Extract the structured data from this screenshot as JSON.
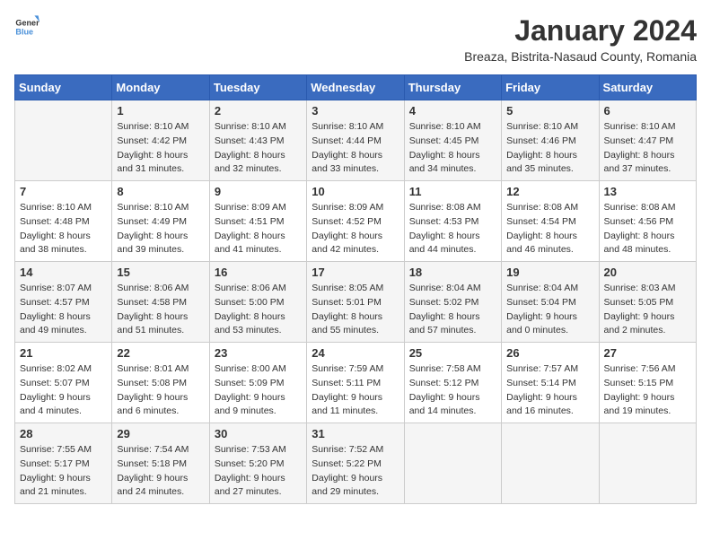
{
  "header": {
    "logo": {
      "general": "General",
      "blue": "Blue"
    },
    "title": "January 2024",
    "subtitle": "Breaza, Bistrita-Nasaud County, Romania"
  },
  "calendar": {
    "weekdays": [
      "Sunday",
      "Monday",
      "Tuesday",
      "Wednesday",
      "Thursday",
      "Friday",
      "Saturday"
    ],
    "weeks": [
      [
        {
          "day": "",
          "sunrise": "",
          "sunset": "",
          "daylight": ""
        },
        {
          "day": "1",
          "sunrise": "Sunrise: 8:10 AM",
          "sunset": "Sunset: 4:42 PM",
          "daylight": "Daylight: 8 hours and 31 minutes."
        },
        {
          "day": "2",
          "sunrise": "Sunrise: 8:10 AM",
          "sunset": "Sunset: 4:43 PM",
          "daylight": "Daylight: 8 hours and 32 minutes."
        },
        {
          "day": "3",
          "sunrise": "Sunrise: 8:10 AM",
          "sunset": "Sunset: 4:44 PM",
          "daylight": "Daylight: 8 hours and 33 minutes."
        },
        {
          "day": "4",
          "sunrise": "Sunrise: 8:10 AM",
          "sunset": "Sunset: 4:45 PM",
          "daylight": "Daylight: 8 hours and 34 minutes."
        },
        {
          "day": "5",
          "sunrise": "Sunrise: 8:10 AM",
          "sunset": "Sunset: 4:46 PM",
          "daylight": "Daylight: 8 hours and 35 minutes."
        },
        {
          "day": "6",
          "sunrise": "Sunrise: 8:10 AM",
          "sunset": "Sunset: 4:47 PM",
          "daylight": "Daylight: 8 hours and 37 minutes."
        }
      ],
      [
        {
          "day": "7",
          "sunrise": "Sunrise: 8:10 AM",
          "sunset": "Sunset: 4:48 PM",
          "daylight": "Daylight: 8 hours and 38 minutes."
        },
        {
          "day": "8",
          "sunrise": "Sunrise: 8:10 AM",
          "sunset": "Sunset: 4:49 PM",
          "daylight": "Daylight: 8 hours and 39 minutes."
        },
        {
          "day": "9",
          "sunrise": "Sunrise: 8:09 AM",
          "sunset": "Sunset: 4:51 PM",
          "daylight": "Daylight: 8 hours and 41 minutes."
        },
        {
          "day": "10",
          "sunrise": "Sunrise: 8:09 AM",
          "sunset": "Sunset: 4:52 PM",
          "daylight": "Daylight: 8 hours and 42 minutes."
        },
        {
          "day": "11",
          "sunrise": "Sunrise: 8:08 AM",
          "sunset": "Sunset: 4:53 PM",
          "daylight": "Daylight: 8 hours and 44 minutes."
        },
        {
          "day": "12",
          "sunrise": "Sunrise: 8:08 AM",
          "sunset": "Sunset: 4:54 PM",
          "daylight": "Daylight: 8 hours and 46 minutes."
        },
        {
          "day": "13",
          "sunrise": "Sunrise: 8:08 AM",
          "sunset": "Sunset: 4:56 PM",
          "daylight": "Daylight: 8 hours and 48 minutes."
        }
      ],
      [
        {
          "day": "14",
          "sunrise": "Sunrise: 8:07 AM",
          "sunset": "Sunset: 4:57 PM",
          "daylight": "Daylight: 8 hours and 49 minutes."
        },
        {
          "day": "15",
          "sunrise": "Sunrise: 8:06 AM",
          "sunset": "Sunset: 4:58 PM",
          "daylight": "Daylight: 8 hours and 51 minutes."
        },
        {
          "day": "16",
          "sunrise": "Sunrise: 8:06 AM",
          "sunset": "Sunset: 5:00 PM",
          "daylight": "Daylight: 8 hours and 53 minutes."
        },
        {
          "day": "17",
          "sunrise": "Sunrise: 8:05 AM",
          "sunset": "Sunset: 5:01 PM",
          "daylight": "Daylight: 8 hours and 55 minutes."
        },
        {
          "day": "18",
          "sunrise": "Sunrise: 8:04 AM",
          "sunset": "Sunset: 5:02 PM",
          "daylight": "Daylight: 8 hours and 57 minutes."
        },
        {
          "day": "19",
          "sunrise": "Sunrise: 8:04 AM",
          "sunset": "Sunset: 5:04 PM",
          "daylight": "Daylight: 9 hours and 0 minutes."
        },
        {
          "day": "20",
          "sunrise": "Sunrise: 8:03 AM",
          "sunset": "Sunset: 5:05 PM",
          "daylight": "Daylight: 9 hours and 2 minutes."
        }
      ],
      [
        {
          "day": "21",
          "sunrise": "Sunrise: 8:02 AM",
          "sunset": "Sunset: 5:07 PM",
          "daylight": "Daylight: 9 hours and 4 minutes."
        },
        {
          "day": "22",
          "sunrise": "Sunrise: 8:01 AM",
          "sunset": "Sunset: 5:08 PM",
          "daylight": "Daylight: 9 hours and 6 minutes."
        },
        {
          "day": "23",
          "sunrise": "Sunrise: 8:00 AM",
          "sunset": "Sunset: 5:09 PM",
          "daylight": "Daylight: 9 hours and 9 minutes."
        },
        {
          "day": "24",
          "sunrise": "Sunrise: 7:59 AM",
          "sunset": "Sunset: 5:11 PM",
          "daylight": "Daylight: 9 hours and 11 minutes."
        },
        {
          "day": "25",
          "sunrise": "Sunrise: 7:58 AM",
          "sunset": "Sunset: 5:12 PM",
          "daylight": "Daylight: 9 hours and 14 minutes."
        },
        {
          "day": "26",
          "sunrise": "Sunrise: 7:57 AM",
          "sunset": "Sunset: 5:14 PM",
          "daylight": "Daylight: 9 hours and 16 minutes."
        },
        {
          "day": "27",
          "sunrise": "Sunrise: 7:56 AM",
          "sunset": "Sunset: 5:15 PM",
          "daylight": "Daylight: 9 hours and 19 minutes."
        }
      ],
      [
        {
          "day": "28",
          "sunrise": "Sunrise: 7:55 AM",
          "sunset": "Sunset: 5:17 PM",
          "daylight": "Daylight: 9 hours and 21 minutes."
        },
        {
          "day": "29",
          "sunrise": "Sunrise: 7:54 AM",
          "sunset": "Sunset: 5:18 PM",
          "daylight": "Daylight: 9 hours and 24 minutes."
        },
        {
          "day": "30",
          "sunrise": "Sunrise: 7:53 AM",
          "sunset": "Sunset: 5:20 PM",
          "daylight": "Daylight: 9 hours and 27 minutes."
        },
        {
          "day": "31",
          "sunrise": "Sunrise: 7:52 AM",
          "sunset": "Sunset: 5:22 PM",
          "daylight": "Daylight: 9 hours and 29 minutes."
        },
        {
          "day": "",
          "sunrise": "",
          "sunset": "",
          "daylight": ""
        },
        {
          "day": "",
          "sunrise": "",
          "sunset": "",
          "daylight": ""
        },
        {
          "day": "",
          "sunrise": "",
          "sunset": "",
          "daylight": ""
        }
      ]
    ]
  }
}
